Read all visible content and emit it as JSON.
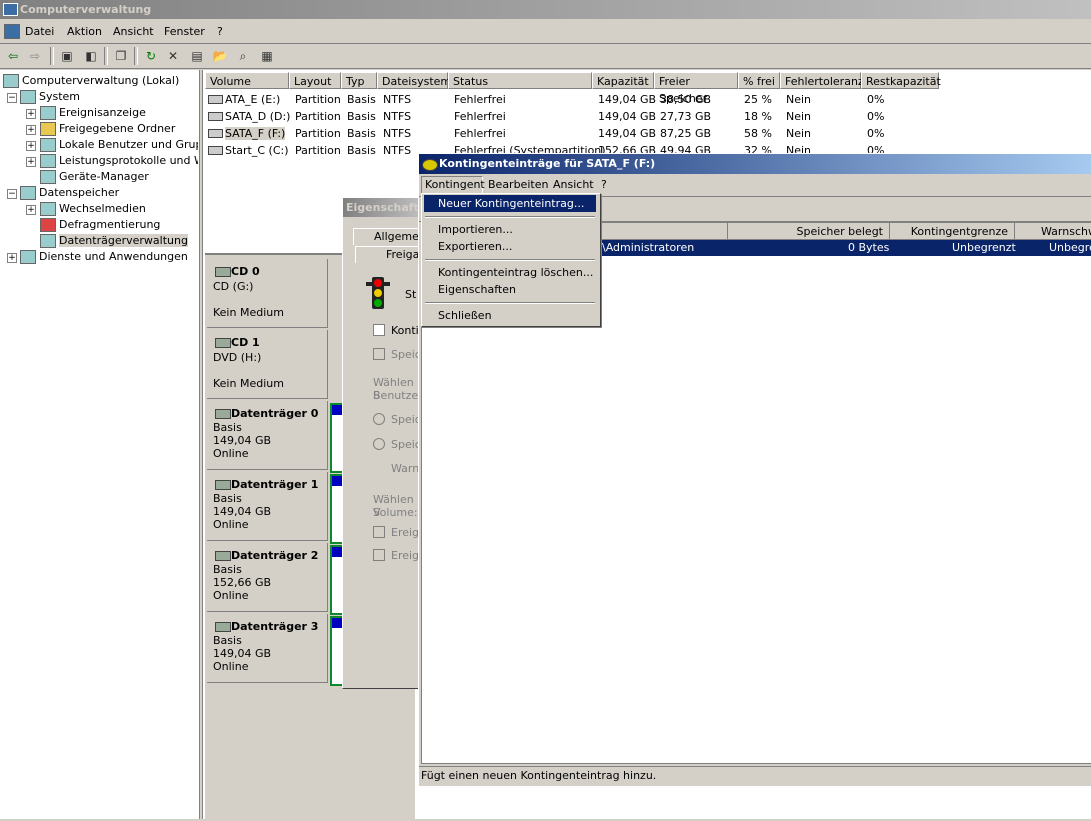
{
  "window": {
    "title": "Computerverwaltung"
  },
  "menu": [
    "Datei",
    "Aktion",
    "Ansicht",
    "Fenster",
    "?"
  ],
  "tree": {
    "root": "Computerverwaltung (Lokal)",
    "system": "System",
    "event_viewer": "Ereignisanzeige",
    "shared_folders": "Freigegebene Ordner",
    "local_users": "Lokale Benutzer und Gruppen",
    "perf_logs": "Leistungsprotokolle und Warnungen",
    "device_manager": "Geräte-Manager",
    "storage": "Datenspeicher",
    "removable": "Wechselmedien",
    "defrag": "Defragmentierung",
    "disk_mgmt": "Datenträgerverwaltung",
    "services": "Dienste und Anwendungen"
  },
  "volume_table": {
    "headers": [
      "Volume",
      "Layout",
      "Typ",
      "Dateisystem",
      "Status",
      "Kapazität",
      "Freier Speicher",
      "% frei",
      "Fehlertoleranz",
      "Restkapazität"
    ],
    "rows": [
      [
        "ATA_E (E:)",
        "Partition",
        "Basis",
        "NTFS",
        "Fehlerfrei",
        "149,04 GB",
        "38,50 GB",
        "25 %",
        "Nein",
        "0%"
      ],
      [
        "SATA_D (D:)",
        "Partition",
        "Basis",
        "NTFS",
        "Fehlerfrei",
        "149,04 GB",
        "27,73 GB",
        "18 %",
        "Nein",
        "0%"
      ],
      [
        "SATA_F (F:)",
        "Partition",
        "Basis",
        "NTFS",
        "Fehlerfrei",
        "149,04 GB",
        "87,25 GB",
        "58 %",
        "Nein",
        "0%"
      ],
      [
        "Start_C (C:)",
        "Partition",
        "Basis",
        "NTFS",
        "Fehlerfrei (Systempartition)",
        "152,66 GB",
        "49,94 GB",
        "32 %",
        "Nein",
        "0%"
      ]
    ]
  },
  "disks": [
    {
      "name": "CD 0",
      "l1": "CD (G:)",
      "l2": "",
      "l3": "Kein Medium"
    },
    {
      "name": "CD 1",
      "l1": "DVD (H:)",
      "l2": "",
      "l3": "Kein Medium"
    },
    {
      "name": "Datenträger 0",
      "l1": "Basis",
      "l2": "149,04 GB",
      "l3": "Online"
    },
    {
      "name": "Datenträger 1",
      "l1": "Basis",
      "l2": "149,04 GB",
      "l3": "Online"
    },
    {
      "name": "Datenträger 2",
      "l1": "Basis",
      "l2": "152,66 GB",
      "l3": "Online"
    },
    {
      "name": "Datenträger 3",
      "l1": "Basis",
      "l2": "149,04 GB",
      "l3": "Online"
    }
  ],
  "properties_dialog": {
    "title": "Eigenschaften",
    "tab_general": "Allgemein",
    "tab_share": "Freigabe",
    "status_prefix": "St",
    "chk1": "Konti",
    "chk2": "Speic",
    "choose1": "Wählen S",
    "choose1b": "Benutzer",
    "radio1": "Speic",
    "radio2": "Speic",
    "warn": "Warn",
    "choose2": "Wählen S",
    "choose2b": "Volume:",
    "chk3": "Ereig",
    "chk4": "Ereig"
  },
  "quota_window": {
    "title": "Kontingenteinträge für SATA_F (F:)",
    "menu": [
      "Kontingent",
      "Bearbeiten",
      "Ansicht",
      "?"
    ],
    "headers": [
      "Speicher belegt",
      "Kontingentgrenze",
      "Warnschwelle"
    ],
    "row": {
      "name": "\\Administratoren",
      "used": "0 Bytes",
      "limit": "Unbegrenzt",
      "warn": "Unbegrenzt"
    },
    "status": "Fügt einen neuen Kontingenteintrag hinzu."
  },
  "dropdown": {
    "new": "Neuer Kontingenteintrag...",
    "import": "Importieren...",
    "export": "Exportieren...",
    "delete": "Kontingenteintrag löschen...",
    "props": "Eigenschaften",
    "close": "Schließen"
  }
}
